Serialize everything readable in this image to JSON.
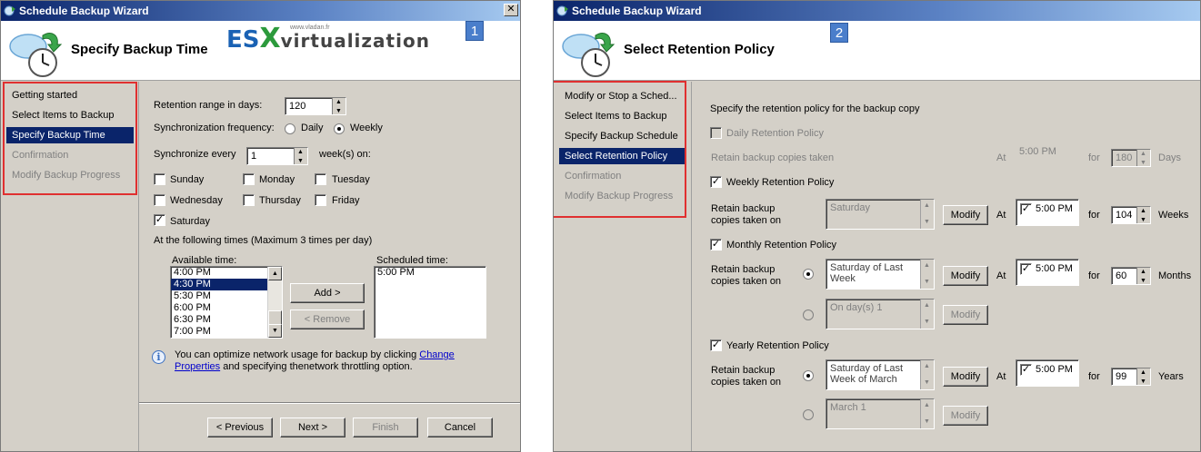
{
  "w1": {
    "title": "Schedule Backup Wizard",
    "close": "✕",
    "header_title": "Specify Backup Time",
    "badge": "1",
    "logo": {
      "es": "ES",
      "x": "X",
      "virt": "virtualization",
      "site": "www.vladan.fr"
    },
    "nav": [
      "Getting started",
      "Select Items to Backup",
      "Specify Backup Time",
      "Confirmation",
      "Modify Backup Progress"
    ],
    "retention_label": "Retention range in days:",
    "retention_value": "120",
    "sync_freq_label": "Synchronization frequency:",
    "daily": "Daily",
    "weekly": "Weekly",
    "sync_every_label": "Synchronize every",
    "sync_every_value": "1",
    "weeks_on": "week(s) on:",
    "days": {
      "sunday": "Sunday",
      "monday": "Monday",
      "tuesday": "Tuesday",
      "wednesday": "Wednesday",
      "thursday": "Thursday",
      "friday": "Friday",
      "saturday": "Saturday"
    },
    "times_label": "At the following times (Maximum 3 times per day)",
    "available_label": "Available time:",
    "available": [
      "4:00 PM",
      "4:30 PM",
      "5:30 PM",
      "6:00 PM",
      "6:30 PM",
      "7:00 PM"
    ],
    "scheduled_label": "Scheduled time:",
    "scheduled": [
      "5:00 PM"
    ],
    "add": "Add >",
    "remove": "< Remove",
    "info_pre": "You can optimize network usage for backup by clicking",
    "info_link1": "Change",
    "info_link2": "Properties",
    "info_post": "and specifying thenetwork throttling option.",
    "prev": "< Previous",
    "next": "Next >",
    "finish": "Finish",
    "cancel": "Cancel"
  },
  "w2": {
    "title": "Schedule Backup Wizard",
    "header_title": "Select Retention Policy",
    "badge": "2",
    "nav": [
      "Modify or Stop a Sched...",
      "Select Items to Backup",
      "Specify Backup Schedule",
      "Select Retention Policy",
      "Confirmation",
      "Modify Backup Progress"
    ],
    "intro": "Specify the retention policy for the backup copy",
    "daily_label": "Daily Retention Policy",
    "daily_retain": "Retain backup copies taken",
    "at": "At",
    "for": "for",
    "daily_time": "5:00 PM",
    "daily_value": "180",
    "days": "Days",
    "weekly_label": "Weekly Retention Policy",
    "retain_l1": "Retain backup",
    "retain_l2": "copies taken on",
    "weekly_day": "Saturday",
    "modify": "Modify",
    "weekly_time": "5:00 PM",
    "weekly_value": "104",
    "weeks": "Weeks",
    "monthly_label": "Monthly Retention Policy",
    "monthly_opt1_l1": "Saturday of Last",
    "monthly_opt1_l2": "Week",
    "monthly_opt2": "On day(s) 1",
    "monthly_time": "5:00 PM",
    "monthly_value": "60",
    "months": "Months",
    "yearly_label": "Yearly Retention Policy",
    "yearly_opt1_l1": "Saturday of Last",
    "yearly_opt1_l2": "Week of March",
    "yearly_opt2": "March 1",
    "yearly_time": "5:00 PM",
    "yearly_value": "99",
    "years": "Years",
    "check": "✓"
  }
}
